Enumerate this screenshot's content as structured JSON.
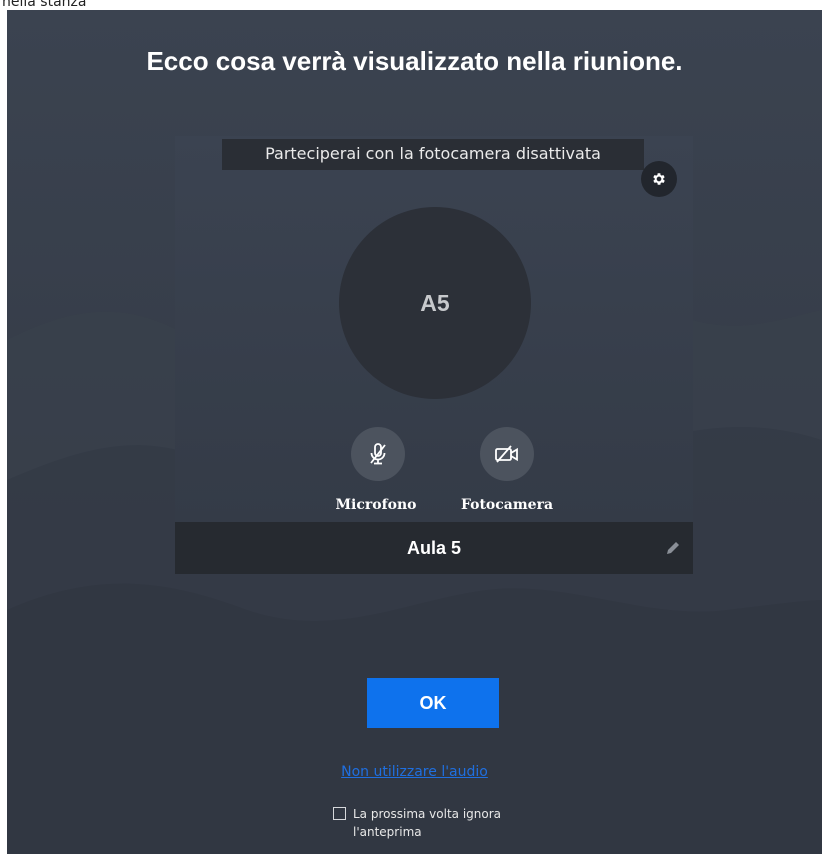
{
  "window": {
    "title": "nella stanza"
  },
  "heading": "Ecco cosa verrà visualizzato nella riunione.",
  "preview": {
    "status_banner": "Parteciperai con la fotocamera disattivata",
    "avatar_initials": "A5",
    "mic_label": "Microfono",
    "camera_label": "Fotocamera",
    "display_name": "Aula 5",
    "icons": {
      "settings": "gear-icon",
      "mic": "microphone-muted-icon",
      "camera": "camera-off-icon",
      "edit": "pencil-icon"
    }
  },
  "actions": {
    "ok_label": "OK",
    "no_audio_link": "Non utilizzare l'audio",
    "skip_preview_line1": "La prossima volta ignora",
    "skip_preview_line2": "l'anteprima",
    "skip_preview_checked": false
  },
  "colors": {
    "background": "#353c48",
    "accent_button": "#0e72ed",
    "link": "#1f6fe0",
    "name_bar": "#262a30"
  }
}
